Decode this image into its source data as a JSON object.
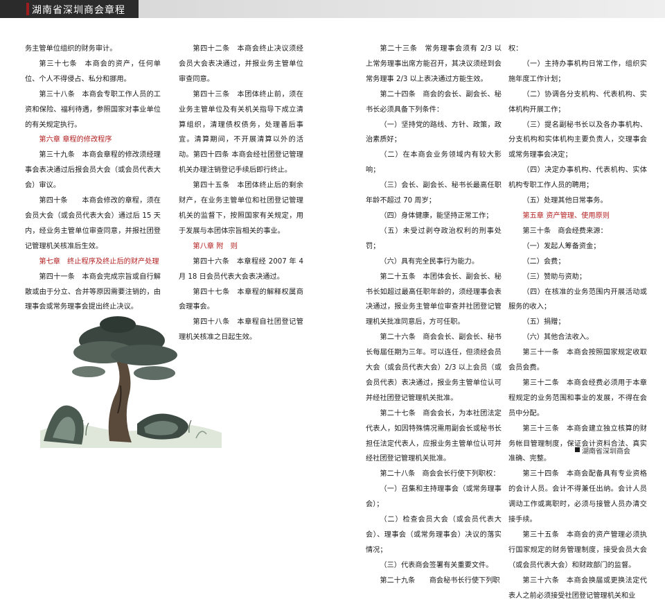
{
  "header": {
    "title": "湖南省深圳商会章程"
  },
  "columns": {
    "c1": [
      {
        "t": "务主管单位组织的财务审计。",
        "cls": ""
      },
      {
        "t": "第三十七条　本商会的资产，任何单位、个人不得侵占、私分和挪用。",
        "cls": "ind"
      },
      {
        "t": "第三十八条　本商会专职工作人员的工资和保险、福利待遇，参照国家对事业单位的有关规定执行。",
        "cls": "ind"
      },
      {
        "t": "第六章 章程的修改程序",
        "cls": "ind red"
      },
      {
        "t": "第三十九条　本商会章程的修改须经理事会表决通过后报会员大会（或会员代表大会）审议。",
        "cls": "ind"
      },
      {
        "t": "第四十条　　本商会修改的章程，须在会员大会（或会员代表大会）通过后 15 天内，经业务主管单位审查同意，并报社团登记管理机关核准后生效。",
        "cls": "ind"
      },
      {
        "t": "第七章　终止程序及终止后的财产处理",
        "cls": "ind red"
      },
      {
        "t": "第四十一条　本商会完成宗旨或自行解散或由于分立、合并等原因需要注销的，由理事会或常务理事会提出终止决议。",
        "cls": "ind"
      }
    ],
    "c2": [
      {
        "t": "第四十二条　本商会终止决议须经会员大会表决通过，并报业务主管单位审查同意。",
        "cls": "ind"
      },
      {
        "t": "第四十三条　本团体终止前，须在业务主管单位及有关机关指导下成立清算组织，清理债权债务，处理善后事宜。清算期间，不开展清算以外的活动。第四十四条 本商会经社团登记管理机关办理注销登记手续后即行终止。",
        "cls": "ind"
      },
      {
        "t": "第四十五条　本团体终止后的剩余财产，在业务主管单位和社团登记管理机关的监督下，按照国家有关规定，用于发展与本团体宗旨相关的事业。",
        "cls": "ind"
      },
      {
        "t": "第八章 附　则",
        "cls": "ind red"
      },
      {
        "t": "第四十六条　本章程经 2007 年 4 月 18 日会员代表大会表决通过。",
        "cls": "ind"
      },
      {
        "t": "第四十七条　本章程的解释权属商会理事会。",
        "cls": "ind"
      },
      {
        "t": "第四十八条　本章程自社团登记管理机关核准之日起生效。",
        "cls": "ind"
      }
    ],
    "c3": [
      {
        "t": "第二十三条　常务理事会须有 2/3 以上常务理事出席方能召开，其决议须经到会常务理事 2/3 以上表决通过方能生效。",
        "cls": "ind"
      },
      {
        "t": "第二十四条　商会的会长、副会长、秘书长必须具备下列条件：",
        "cls": "ind"
      },
      {
        "t": "（一）坚持党的路线、方针、政策，政治素质好；",
        "cls": "ind"
      },
      {
        "t": "（二）在本商会业务领域内有较大影响；",
        "cls": "ind"
      },
      {
        "t": "（三）会长、副会长、秘书长最高任职年龄不超过 70 周岁；",
        "cls": "ind"
      },
      {
        "t": "（四）身体健康，能坚持正常工作；",
        "cls": "ind"
      },
      {
        "t": "（五）未受过剥夺政治权利的刑事处罚；",
        "cls": "ind"
      },
      {
        "t": "（六）具有完全民事行为能力。",
        "cls": "ind"
      },
      {
        "t": "第二十五条　本团体会长、副会长、秘书长如超过最高任职年龄的，须经理事会表决通过，报业务主管单位审查并社团登记管理机关批准同意后，方可任职。",
        "cls": "ind"
      },
      {
        "t": "第二十六条　商会会长、副会长、秘书长每届任期为三年。可以连任，但须经会员大会（或会员代表大会）2/3 以上会员（或会员代表）表决通过，报业务主管单位认可并经社团登记管理机关批准。",
        "cls": "ind"
      },
      {
        "t": "第二十七条　商会会长，为本社团法定代表人，如因特殊情况需用副会长或秘书长担任法定代表人，应报业务主管单位认可并经社团登记管理机关批准。",
        "cls": "ind"
      },
      {
        "t": "第二十八条　商会会长行使下列职权：",
        "cls": "ind"
      },
      {
        "t": "（一）召集和主持理事会（或常务理事会）；",
        "cls": "ind"
      },
      {
        "t": "（二）检查会员大会（或会员代表大会）、理事会（或常务理事会）决议的落实情况；",
        "cls": "ind"
      },
      {
        "t": "（三）代表商会签署有关重要文件。",
        "cls": "ind"
      },
      {
        "t": "第二十九条　　商会秘书长行使下列职",
        "cls": "ind"
      }
    ],
    "c4": [
      {
        "t": "权：",
        "cls": ""
      },
      {
        "t": "（一）主持办事机构日常工作，组织实施年度工作计划；",
        "cls": "ind"
      },
      {
        "t": "（二）协调各分支机构、代表机构、实体机构开展工作；",
        "cls": "ind"
      },
      {
        "t": "（三）提名副秘书长以及各办事机构、分支机构和实体机构主要负责人，交理事会或常务理事会决定；",
        "cls": "ind"
      },
      {
        "t": "（四）决定办事机构、代表机构、实体机构专职工作人员的聘用；",
        "cls": "ind"
      },
      {
        "t": "（五）处理其他日常事务。",
        "cls": "ind"
      },
      {
        "t": "第五章 资产管理、使用原则",
        "cls": "ind red"
      },
      {
        "t": "第三十条　商会经费来源：",
        "cls": "ind"
      },
      {
        "t": "（一）发起人筹备资金；",
        "cls": "ind"
      },
      {
        "t": "（二）会费；",
        "cls": "ind"
      },
      {
        "t": "（三）赞助与资助；",
        "cls": "ind"
      },
      {
        "t": "（四）在核准的业务范围内开展活动或服务的收入；",
        "cls": "ind"
      },
      {
        "t": "（五）捐赠；",
        "cls": "ind"
      },
      {
        "t": "（六）其他合法收入。",
        "cls": "ind"
      },
      {
        "t": "第三十一条　本商会按照国家规定收取会员会费。",
        "cls": "ind"
      },
      {
        "t": "第三十二条　本商会经费必须用于本章程规定的业务范围和事业的发展，不得在会员中分配。",
        "cls": "ind"
      },
      {
        "t": "第三十三条　本商会建立独立核算的财务帐目管理制度，保证会计资料合法、真实准确、完整。",
        "cls": "ind"
      },
      {
        "t": "第三十四条　本商会配备具有专业资格的会计人员。会计不得兼任出纳。会计人员调动工作或离职时，必须与接管人员办清交接手续。",
        "cls": "ind"
      },
      {
        "t": "第三十五条　本商会的资产管理必须执行国家规定的财务管理制度，接受会员大会（或会员代表大会）和财政部门的监督。",
        "cls": "ind"
      },
      {
        "t": "第三十六条　本商会换届或更换法定代表人之前必须接受社团登记管理机关和业",
        "cls": "ind"
      }
    ]
  },
  "footer": {
    "text": "湖南省深圳商会"
  },
  "colors": {
    "header_dark": "#2b2b2b",
    "accent_red": "#b21e1e"
  },
  "icons": {
    "painting": "ink-landscape-pine-painting"
  }
}
